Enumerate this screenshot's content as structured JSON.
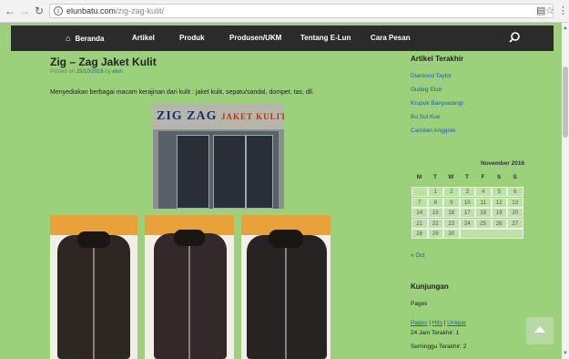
{
  "browser": {
    "url_domain": "elunbatu.com",
    "url_path": "/zig-zag-kulit/"
  },
  "menu": {
    "items": [
      "Beranda",
      "Artikel",
      "Produk",
      "Produsen/UKM",
      "Tentang E-Lun",
      "Cara Pesan"
    ]
  },
  "post": {
    "title": "Zig – Zag Jaket Kulit",
    "meta_prefix": "Posted on",
    "date": "15/10/2016",
    "meta_by": "by",
    "author": "elun",
    "excerpt": "Menyediakan berbagai macam kerajinan dari kulit : jaket kulit, sepatu/sandal, dompet, tas,  dll.",
    "sign_main": "ZIG ZAG",
    "sign_sub": "JAKET KULIT"
  },
  "sidebar": {
    "recent_title": "Artikel Terakhir",
    "recent_links": [
      "Diamond Taylor",
      "Gudeg Elun",
      "Krupuk Banyuwangi",
      "Bu Sul Kue",
      "Camilan Anggrek"
    ],
    "calendar_caption": "November 2016",
    "weekday_headers": [
      "M",
      "T",
      "W",
      "T",
      "F",
      "S",
      "S"
    ],
    "calendar_days": [
      "1",
      "2",
      "3",
      "4",
      "5",
      "6",
      "7",
      "8",
      "9",
      "10",
      "11",
      "12",
      "13",
      "14",
      "15",
      "16",
      "17",
      "18",
      "19",
      "20",
      "21",
      "22",
      "23",
      "24",
      "25",
      "26",
      "27",
      "28",
      "29",
      "30"
    ],
    "prev_month": "« Oct",
    "visits_title": "Kunjungan",
    "pages_label": "Pages",
    "stat_pages": "Pages",
    "stat_hits": "Hits",
    "stat_unique": "Unique",
    "stat_sep": "|",
    "last24": "24 Jam Terakhir: 1",
    "lastweek": "Seminggu Terakhir: 2"
  }
}
